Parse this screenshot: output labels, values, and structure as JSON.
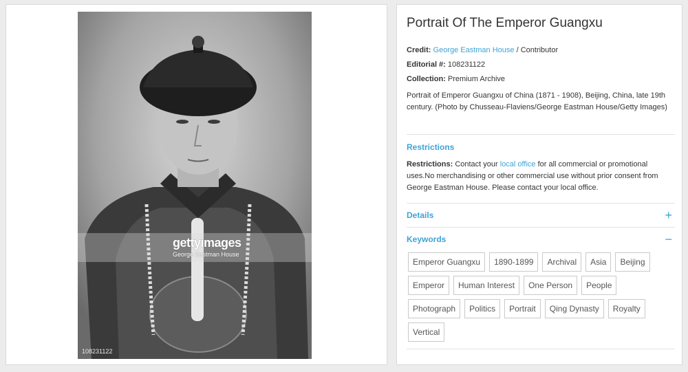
{
  "photo": {
    "watermark_logo": "gettyimages",
    "watermark_sub": "George Eastman House",
    "image_id": "108231122"
  },
  "details_panel": {
    "title": "Portrait Of The Emperor Guangxu",
    "credit_label": "Credit:",
    "credit_link": "George Eastman House",
    "credit_suffix": "/ Contributor",
    "editorial_label": "Editorial #:",
    "editorial_value": "108231122",
    "collection_label": "Collection:",
    "collection_value": "Premium Archive",
    "description": "Portrait of Emperor Guangxu of China (1871 - 1908), Beijing, China, late 19th century. (Photo by Chusseau-Flaviens/George Eastman House/Getty Images)",
    "restrictions_heading": "Restrictions",
    "restrictions_label": "Restrictions:",
    "restrictions_before_link": "Contact your",
    "restrictions_link": "local office",
    "restrictions_after_link": "for all commercial or promotional uses.No merchandising or other commercial use without prior consent from George Eastman House. Please contact your local office.",
    "details_heading": "Details",
    "details_toggle": "+",
    "keywords_heading": "Keywords",
    "keywords_toggle": "−",
    "keywords": [
      "Emperor Guangxu",
      "1890-1899",
      "Archival",
      "Asia",
      "Beijing",
      "Emperor",
      "Human Interest",
      "One Person",
      "People",
      "Photograph",
      "Politics",
      "Portrait",
      "Qing Dynasty",
      "Royalty",
      "Vertical"
    ]
  },
  "colors": {
    "accent": "#3da3d6",
    "text": "#333333",
    "background": "#ececec"
  }
}
